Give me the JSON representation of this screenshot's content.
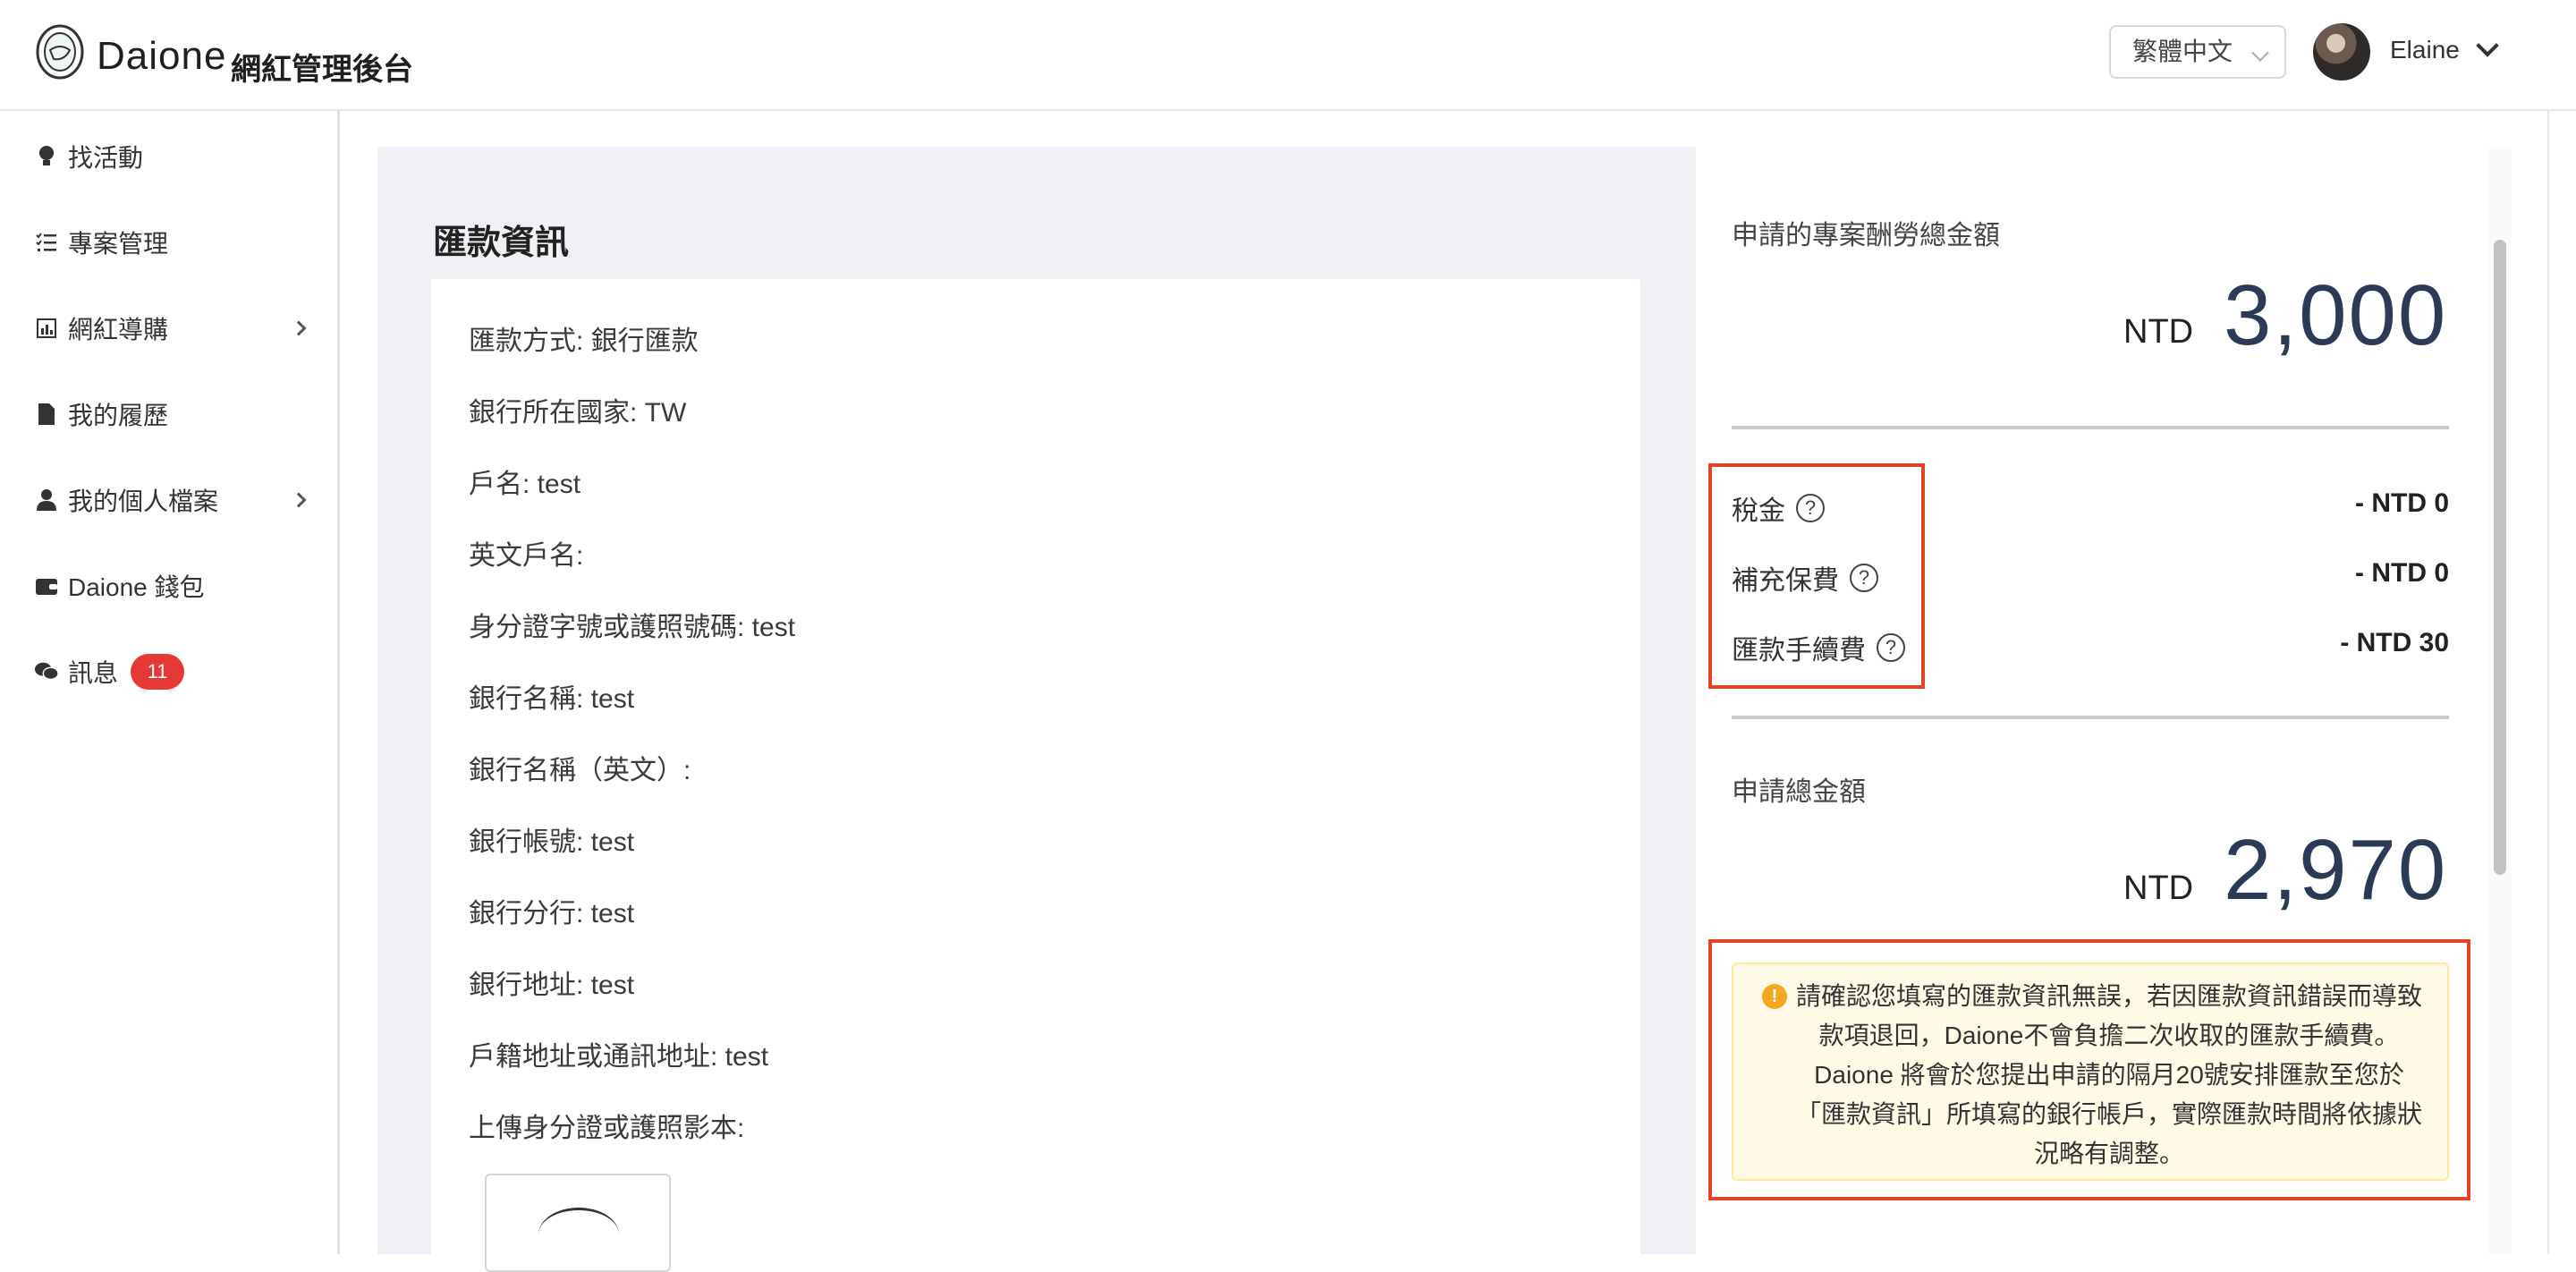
{
  "header": {
    "brand": "Daione",
    "subtitle": "網紅管理後台",
    "language": "繁體中文",
    "user_name": "Elaine"
  },
  "sidebar": {
    "items": [
      {
        "label": "找活動",
        "icon": "lightbulb-icon"
      },
      {
        "label": "專案管理",
        "icon": "list-check-icon"
      },
      {
        "label": "網紅導購",
        "icon": "chart-icon",
        "has_arrow": true
      },
      {
        "label": "我的履歷",
        "icon": "document-icon"
      },
      {
        "label": "我的個人檔案",
        "icon": "user-icon",
        "has_arrow": true
      },
      {
        "label": "Daione 錢包",
        "icon": "wallet-icon"
      },
      {
        "label": "訊息",
        "icon": "chat-icon",
        "badge": "11"
      }
    ]
  },
  "remittance": {
    "title": "匯款資訊",
    "rows": [
      "匯款方式:  銀行匯款",
      "銀行所在國家:  TW",
      "戶名:  test",
      "英文戶名:",
      "身分證字號或護照號碼:  test",
      "銀行名稱:  test",
      "銀行名稱（英文）:",
      "銀行帳號:  test",
      "銀行分行:  test",
      "銀行地址:  test",
      "戶籍地址或通訊地址:  test",
      "上傳身分證或護照影本:"
    ]
  },
  "summary": {
    "total_label": "申請的專案酬勞總金額",
    "currency": "NTD",
    "total_amount": "3,000",
    "fees": [
      {
        "label": "稅金",
        "value": "- NTD 0"
      },
      {
        "label": "補充保費",
        "value": "- NTD 0"
      },
      {
        "label": "匯款手續費",
        "value": "- NTD 30"
      }
    ],
    "apply_label": "申請總金額",
    "apply_amount": "2,970",
    "notice": "請確認您填寫的匯款資訊無誤，若因匯款資訊錯誤而導致款項退回，Daione不會負擔二次收取的匯款手續費。Daione 將會於您提出申請的隔月20號安排匯款至您於「匯款資訊」所填寫的銀行帳戶，實際匯款時間將依據狀況略有調整。"
  },
  "colors": {
    "highlight": "#e2442a",
    "badge": "#e53935",
    "amount": "#2b3a55",
    "notice_bg": "#fffbe6"
  }
}
